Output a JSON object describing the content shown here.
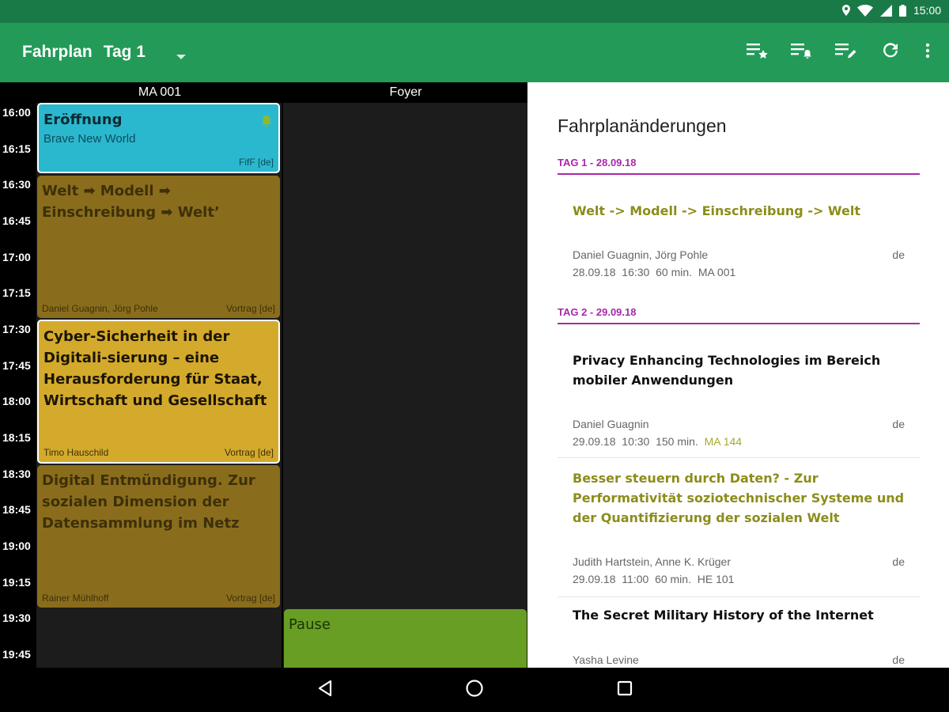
{
  "status_bar": {
    "time": "15:00"
  },
  "app_bar": {
    "title": "Fahrplan",
    "day": "Tag 1"
  },
  "rooms": [
    "MA 001",
    "Foyer"
  ],
  "times": [
    "16:00",
    "16:15",
    "16:30",
    "16:45",
    "17:00",
    "17:15",
    "17:30",
    "17:45",
    "18:00",
    "18:15",
    "18:30",
    "18:45",
    "19:00",
    "19:15",
    "19:30",
    "19:45"
  ],
  "events": [
    {
      "title": "Eröffnung",
      "subtitle": "Brave New World",
      "speakers": "",
      "track": "FifF [de]"
    },
    {
      "title": "Welt ➡ Modell ➡ Einschreibung ➡ Welt’",
      "speakers": "Daniel Guagnin, Jörg Pohle",
      "track": "Vortrag [de]"
    },
    {
      "title": "Cyber-Sicherheit in der Digitali-sierung – eine Herausforderung für  Staat, Wirtschaft und Gesellschaft",
      "speakers": "Timo Hauschild",
      "track": "Vortrag [de]"
    },
    {
      "title": "Digital Entmündigung. Zur sozialen Dimension der Datensammlung im Netz",
      "speakers": "Rainer Mühlhoff",
      "track": "Vortrag [de]"
    },
    {
      "title": "Pause"
    }
  ],
  "changes_panel": {
    "title": "Fahrplanänderungen",
    "days": [
      {
        "header": "TAG 1 - 28.09.18",
        "items": [
          {
            "title": "Welt -> Modell -> Einschreibung -> Welt",
            "speakers": "Daniel Guagnin, Jörg Pohle",
            "lang": "de",
            "date": "28.09.18",
            "time": "16:30",
            "duration": "60 min.",
            "room": "MA 001"
          }
        ]
      },
      {
        "header": "TAG 2 - 29.09.18",
        "items": [
          {
            "title": "Privacy Enhancing Technologies im Bereich mobiler Anwendungen",
            "speakers": "Daniel Guagnin",
            "lang": "de",
            "date": "29.09.18",
            "time": "10:30",
            "duration": "150 min.",
            "room": "MA 144"
          },
          {
            "title": "Besser steuern durch Daten? - Zur Performativität soziotechnischer Systeme und der Quantifizierung der sozialen Welt",
            "speakers": "Judith Hartstein, Anne K. Krüger",
            "lang": "de",
            "date": "29.09.18",
            "time": "11:00",
            "duration": "60 min.",
            "room": "HE 101"
          },
          {
            "title": "The Secret Military History of the Internet",
            "speakers": "Yasha Levine",
            "lang": "de"
          }
        ]
      }
    ]
  },
  "colors": {
    "status_bar": "#1a7a47",
    "app_bar": "#239a58",
    "event_highlight": "#2ab8cf",
    "event_changed": "#8a6d1c",
    "event_favorite": "#d4aa2c",
    "event_pause": "#689e24",
    "day_header": "#a62aa8",
    "changed_text": "#8c8d1a"
  },
  "icons": {
    "status": [
      "location-icon",
      "wifi-icon",
      "cell-signal-icon",
      "battery-icon"
    ],
    "toolbar": [
      "favorites-list-icon",
      "alarms-list-icon",
      "changes-list-icon",
      "refresh-icon",
      "more-vert-icon"
    ],
    "nav": [
      "back-icon",
      "home-icon",
      "recents-icon"
    ]
  }
}
